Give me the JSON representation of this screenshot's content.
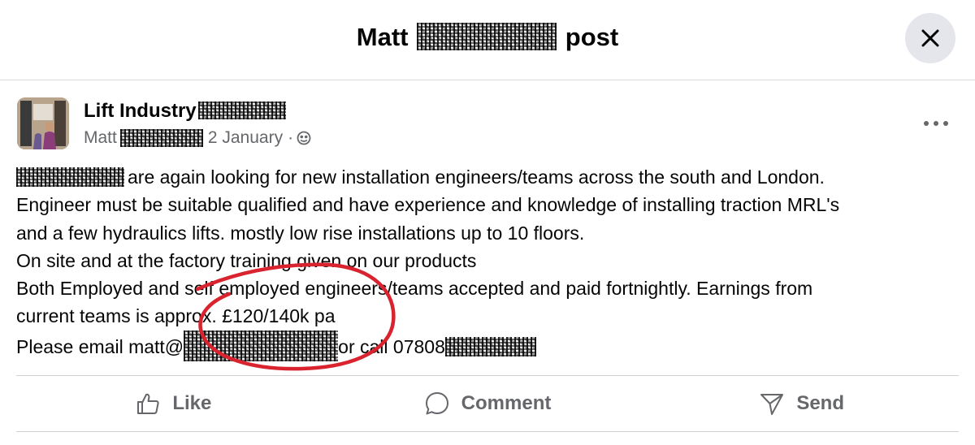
{
  "header": {
    "title_prefix": "Matt",
    "title_suffix": "post"
  },
  "post": {
    "group_name": "Lift Industry",
    "author": "Matt",
    "date": "2 January",
    "separator": "·",
    "audience_icon": "globe-icon",
    "body": {
      "line1": "are again looking for new installation engineers/teams across the south and London.",
      "line2": "Engineer must be suitable qualified and have experience and knowledge of installing traction MRL's",
      "line3": "and a few hydraulics lifts. mostly low rise installations up to 10 floors.",
      "line4": "On site and at the factory training given on our products",
      "line5": "Both Employed and self employed engineers/teams accepted and paid fortnightly. Earnings from",
      "line6": "current teams is approx. £120/140k pa",
      "line7_before": "Please email matt@",
      "line7_middle": "or call 07808"
    }
  },
  "actions": {
    "like": "Like",
    "comment": "Comment",
    "send": "Send"
  },
  "icons": {
    "close": "close-icon",
    "more": "more-options-icon",
    "like": "thumbs-up-icon",
    "comment": "comment-bubble-icon",
    "send": "send-icon"
  },
  "colors": {
    "annotation": "#d9232e",
    "secondary_text": "#65676b",
    "close_button_bg": "#e4e6eb"
  }
}
